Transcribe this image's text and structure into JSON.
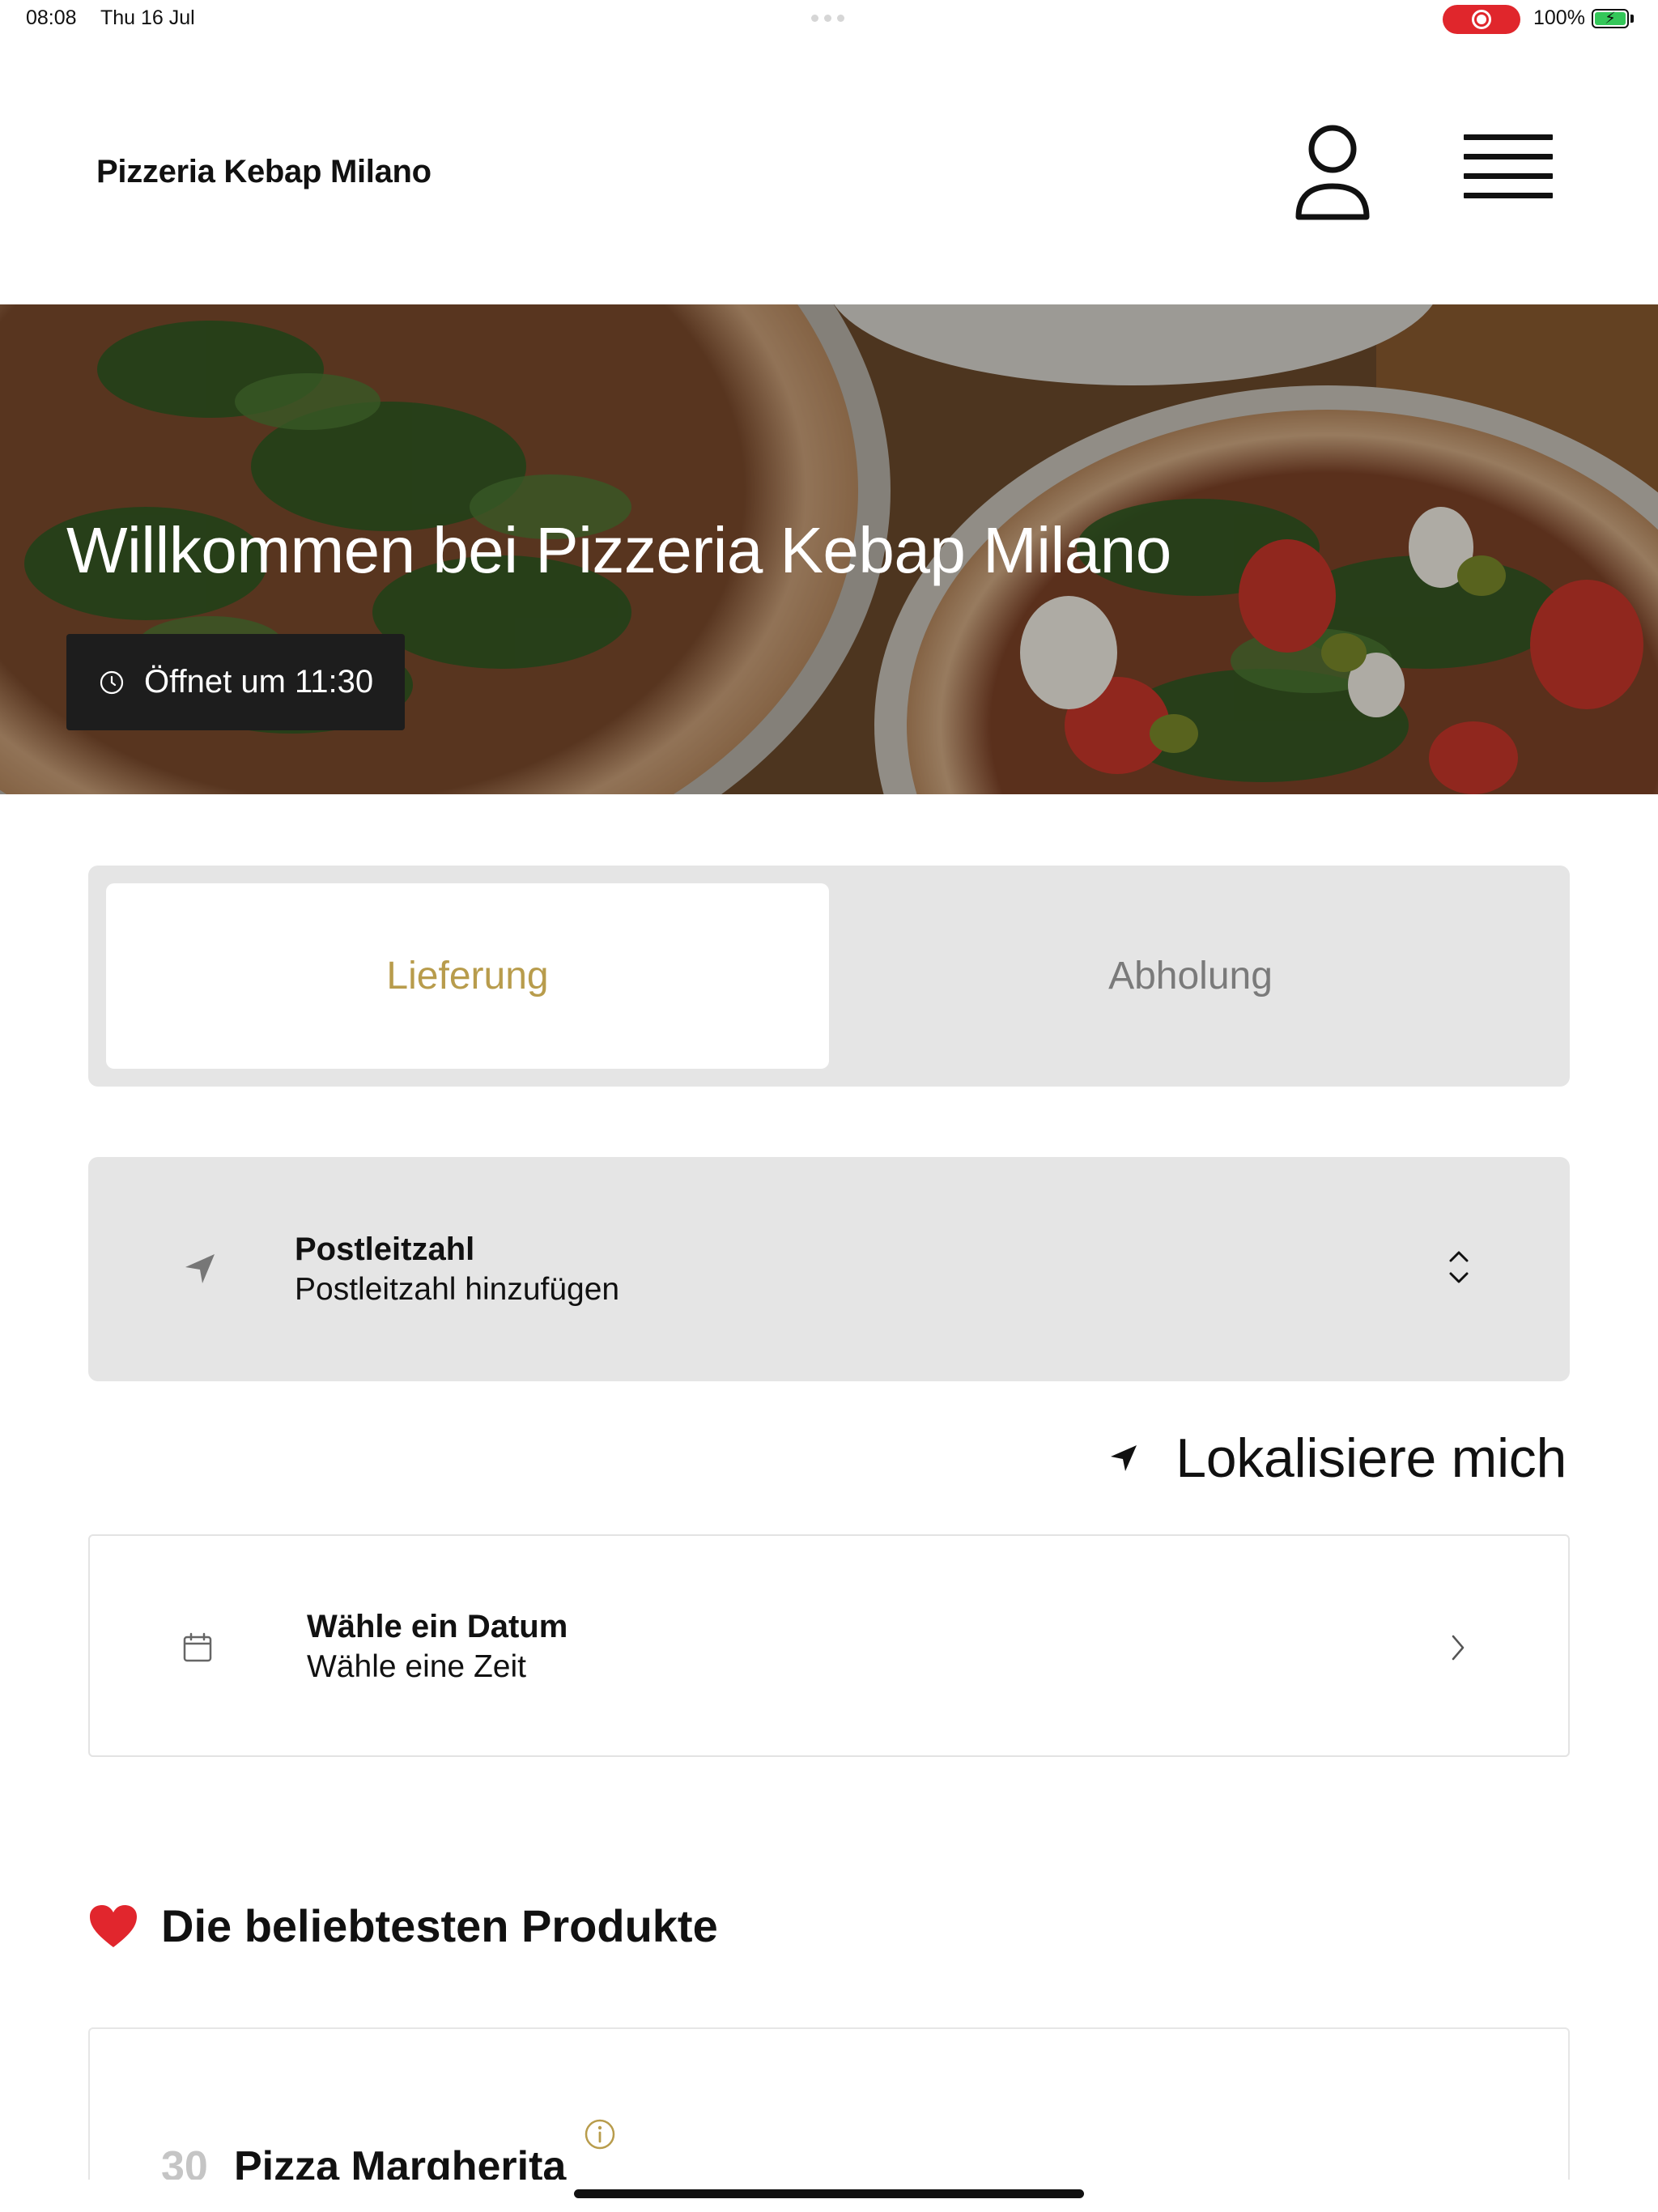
{
  "status_bar": {
    "time": "08:08",
    "date": "Thu 16 Jul",
    "battery": "100%",
    "record_color": "#e0262c",
    "battery_color": "#34c759"
  },
  "header": {
    "brand": "Pizzeria Kebap Milano",
    "account_icon": "person-icon",
    "menu_icon": "hamburger-menu-icon"
  },
  "hero": {
    "title": "Willkommen bei Pizzeria Kebap Milano",
    "open_status": "Öffnet um 11:30",
    "image": "pizza-photo"
  },
  "order_mode": {
    "options": [
      "Lieferung",
      "Abholung"
    ],
    "selected": "Lieferung",
    "accent_color": "#b89c4c"
  },
  "postal_code": {
    "label": "Postleitzahl",
    "value": "Postleitzahl hinzufügen"
  },
  "locate": {
    "label": "Lokalisiere mich"
  },
  "date_time": {
    "label": "Wähle ein Datum",
    "value": "Wähle eine Zeit"
  },
  "popular": {
    "title": "Die beliebtesten Produkte",
    "icon": "heart-icon",
    "products": [
      {
        "number": "30",
        "name": "Pizza Margherita"
      }
    ]
  }
}
